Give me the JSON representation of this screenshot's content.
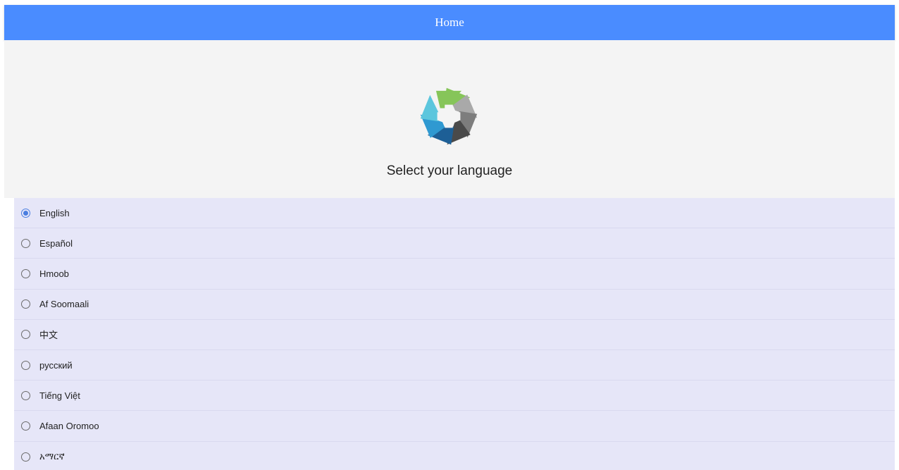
{
  "app_bar": {
    "title": "Home"
  },
  "hero": {
    "prompt": "Select your language",
    "logo_icon": "health-cross-logo"
  },
  "languages": [
    {
      "label": "English",
      "selected": true
    },
    {
      "label": "Español",
      "selected": false
    },
    {
      "label": "Hmoob",
      "selected": false
    },
    {
      "label": "Af Soomaali",
      "selected": false
    },
    {
      "label": "中文",
      "selected": false
    },
    {
      "label": "русский",
      "selected": false
    },
    {
      "label": "Tiếng Việt",
      "selected": false
    },
    {
      "label": "Afaan Oromoo",
      "selected": false
    },
    {
      "label": "አማርኛ",
      "selected": false
    }
  ],
  "colors": {
    "app_bar": "#4a8cff",
    "hero_bg": "#f4f4f4",
    "list_bg": "#e6e6f8",
    "radio_selected": "#4a7ee0"
  }
}
